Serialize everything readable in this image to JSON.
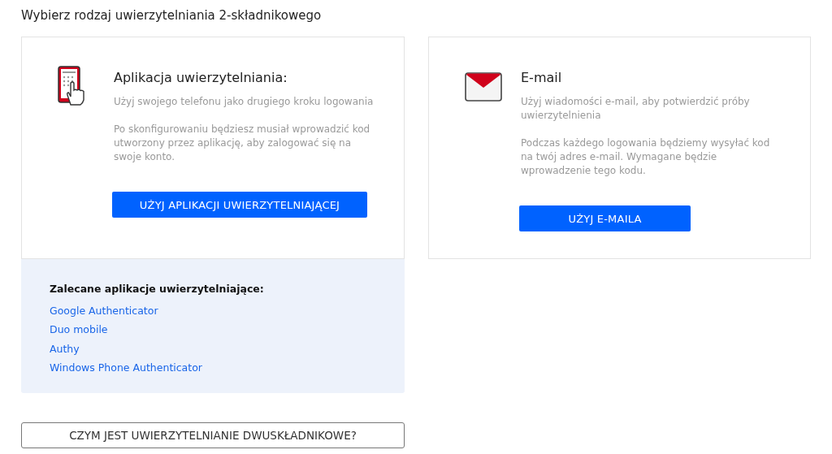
{
  "heading": "Wybierz rodzaj uwierzytelniania 2-składnikowego",
  "methods": [
    {
      "kind": "app",
      "title": "Aplikacja uwierzytelniania:",
      "paragraphs": [
        "Użyj swojego telefonu jako drugiego kroku logowania",
        "Po skonfigurowaniu będziesz musiał wprowadzić kod utworzony przez aplikację, aby zalogować się na swoje konto."
      ],
      "button": "UŻYJ APLIKACJI UWIERZYTELNIAJĄCEJ"
    },
    {
      "kind": "email",
      "title": "E-mail",
      "paragraphs": [
        "Użyj wiadomości e-mail, aby potwierdzić próby uwierzytelnienia",
        "Podczas każdego logowania będziemy wysyłać kod na twój adres e-mail. Wymagane będzie wprowadzenie tego kodu."
      ],
      "button": "UŻYJ E-MAILA"
    }
  ],
  "recommended": {
    "title": "Zalecane aplikacje uwierzytelniające:",
    "links": [
      "Google Authenticator",
      "Duo mobile",
      "Authy",
      "Windows Phone Authenticator"
    ]
  },
  "help_button": "CZYM JEST UWIERZYTELNIANIE DWUSKŁADNIKOWE?"
}
